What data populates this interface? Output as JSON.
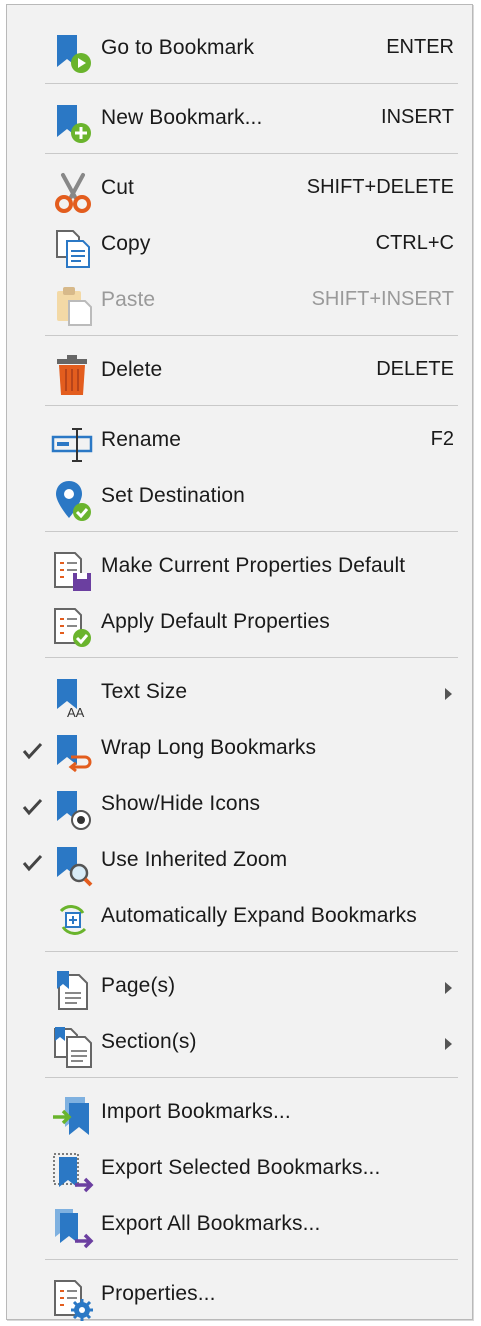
{
  "menu": {
    "items": [
      {
        "id": "goto",
        "label": "Go to Bookmark",
        "shortcut": "ENTER",
        "icon": "go-to-bookmark-icon"
      },
      {
        "id": "new",
        "label": "New Bookmark...",
        "shortcut": "INSERT",
        "icon": "new-bookmark-icon"
      },
      {
        "id": "cut",
        "label": "Cut",
        "shortcut": "SHIFT+DELETE",
        "icon": "scissors-icon"
      },
      {
        "id": "copy",
        "label": "Copy",
        "shortcut": "CTRL+C",
        "icon": "copy-icon"
      },
      {
        "id": "paste",
        "label": "Paste",
        "shortcut": "SHIFT+INSERT",
        "icon": "paste-icon",
        "disabled": true
      },
      {
        "id": "delete",
        "label": "Delete",
        "shortcut": "DELETE",
        "icon": "trash-icon"
      },
      {
        "id": "rename",
        "label": "Rename",
        "shortcut": "F2",
        "icon": "rename-icon"
      },
      {
        "id": "setdest",
        "label": "Set Destination",
        "shortcut": "",
        "icon": "location-pin-icon"
      },
      {
        "id": "makedefault",
        "label": "Make Current Properties Default",
        "shortcut": "",
        "icon": "save-properties-icon"
      },
      {
        "id": "applydefault",
        "label": "Apply Default Properties",
        "shortcut": "",
        "icon": "apply-properties-icon"
      },
      {
        "id": "textsize",
        "label": "Text Size",
        "shortcut": "",
        "icon": "text-size-icon",
        "submenu": true
      },
      {
        "id": "wrap",
        "label": "Wrap Long Bookmarks",
        "shortcut": "",
        "icon": "wrap-icon",
        "checked": true
      },
      {
        "id": "showhide",
        "label": "Show/Hide Icons",
        "shortcut": "",
        "icon": "eye-icon",
        "checked": true
      },
      {
        "id": "inherit",
        "label": "Use Inherited Zoom",
        "shortcut": "",
        "icon": "zoom-icon",
        "checked": true
      },
      {
        "id": "autoexpand",
        "label": "Automatically Expand Bookmarks",
        "shortcut": "",
        "icon": "expand-icon"
      },
      {
        "id": "pages",
        "label": "Page(s)",
        "shortcut": "",
        "icon": "page-icon",
        "submenu": true
      },
      {
        "id": "sections",
        "label": "Section(s)",
        "shortcut": "",
        "icon": "sections-icon",
        "submenu": true
      },
      {
        "id": "import",
        "label": "Import Bookmarks...",
        "shortcut": "",
        "icon": "import-icon"
      },
      {
        "id": "exportsel",
        "label": "Export Selected Bookmarks...",
        "shortcut": "",
        "icon": "export-selected-icon"
      },
      {
        "id": "exportall",
        "label": "Export All Bookmarks...",
        "shortcut": "",
        "icon": "export-all-icon"
      },
      {
        "id": "properties",
        "label": "Properties...",
        "shortcut": "",
        "icon": "properties-icon"
      }
    ]
  },
  "colors": {
    "accent": "#2b78c5",
    "green": "#6ab42d",
    "orange": "#e35d1e",
    "purple": "#6b3fa0",
    "check": "#444444"
  }
}
